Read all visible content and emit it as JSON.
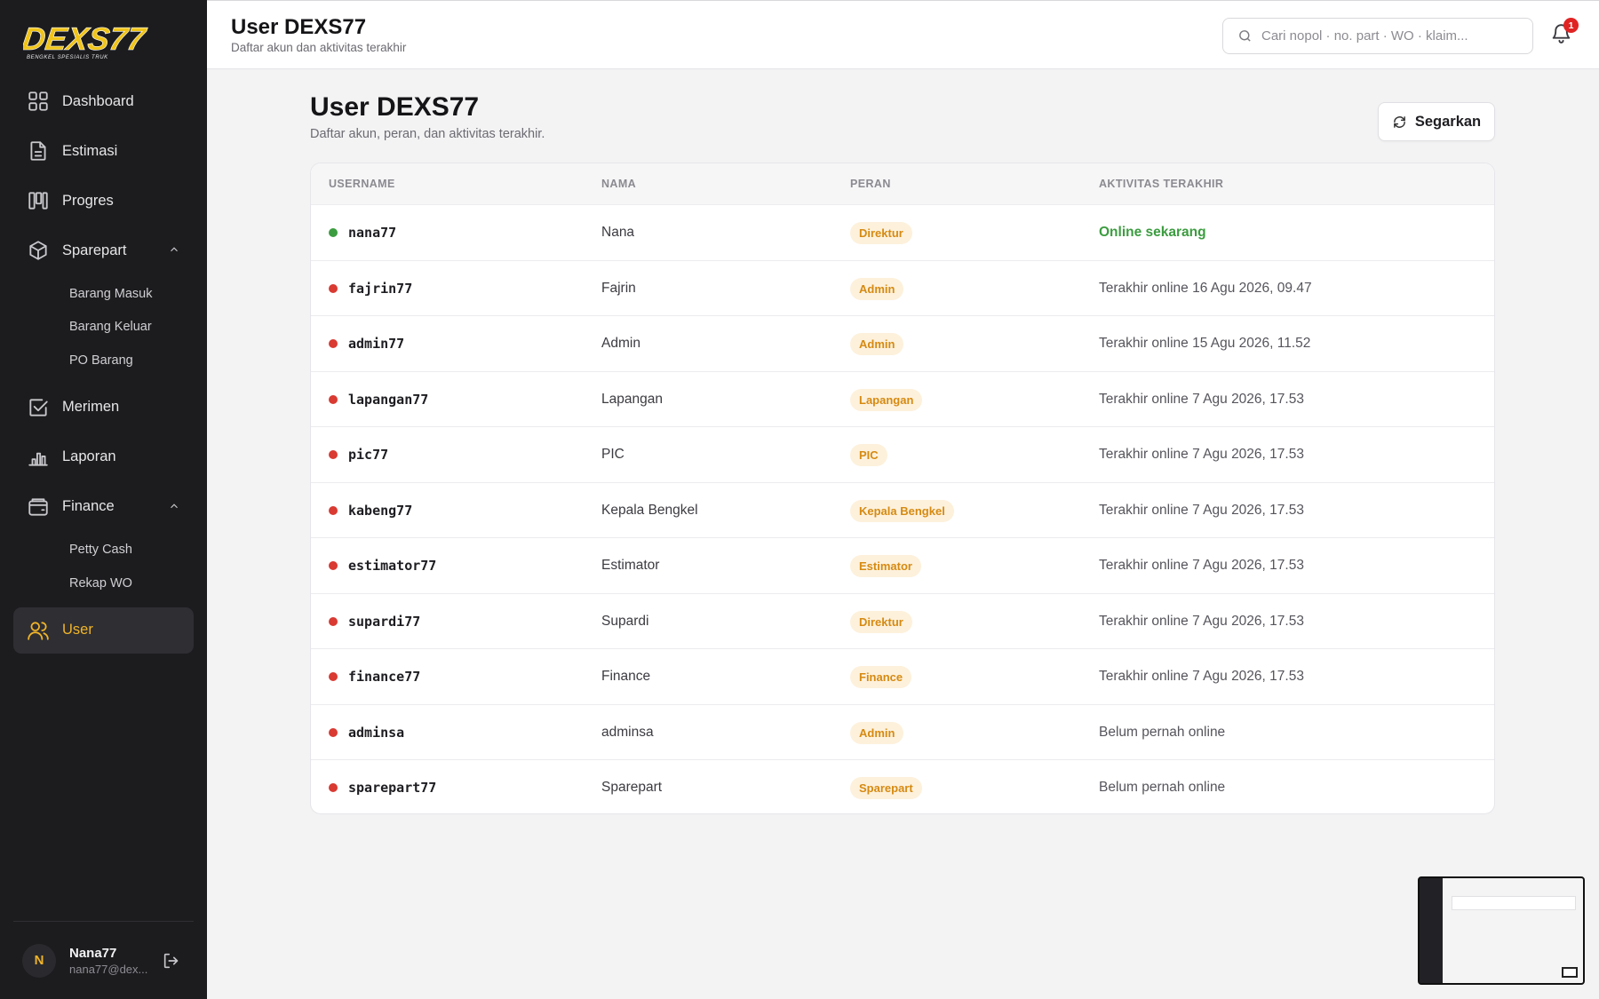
{
  "brand": {
    "logo_text": "DEXS77",
    "logo_tagline": "BENGKEL SPESIALIS TRUK",
    "accent": "#f0b429"
  },
  "sidebar": {
    "items": [
      {
        "label": "Dashboard",
        "icon": "grid-icon"
      },
      {
        "label": "Estimasi",
        "icon": "document-icon"
      },
      {
        "label": "Progres",
        "icon": "kanban-icon"
      },
      {
        "label": "Sparepart",
        "icon": "box-icon",
        "expanded": true,
        "children": [
          "Barang Masuk",
          "Barang Keluar",
          "PO Barang"
        ]
      },
      {
        "label": "Merimen",
        "icon": "checkbox-icon"
      },
      {
        "label": "Laporan",
        "icon": "bar-chart-icon"
      },
      {
        "label": "Finance",
        "icon": "wallet-icon",
        "expanded": true,
        "children": [
          "Petty Cash",
          "Rekap WO"
        ]
      },
      {
        "label": "User",
        "icon": "users-icon",
        "active": true
      }
    ],
    "profile": {
      "initial": "N",
      "name": "Nana77",
      "email": "nana77@dex..."
    }
  },
  "topbar": {
    "title": "User DEXS77",
    "subtitle": "Daftar akun dan aktivitas terakhir",
    "search_placeholder": "Cari nopol · no. part · WO · klaim...",
    "notification_count": "1"
  },
  "main": {
    "title": "User DEXS77",
    "subtitle": "Daftar akun, peran, dan aktivitas terakhir.",
    "refresh_label": "Segarkan",
    "columns": [
      "USERNAME",
      "NAMA",
      "PERAN",
      "AKTIVITAS TERAKHIR"
    ],
    "rows": [
      {
        "username": "nana77",
        "name": "Nana",
        "role": "Direktur",
        "activity": "Online sekarang",
        "online": true
      },
      {
        "username": "fajrin77",
        "name": "Fajrin",
        "role": "Admin",
        "activity": "Terakhir online 16 Agu 2026, 09.47",
        "online": false
      },
      {
        "username": "admin77",
        "name": "Admin",
        "role": "Admin",
        "activity": "Terakhir online 15 Agu 2026, 11.52",
        "online": false
      },
      {
        "username": "lapangan77",
        "name": "Lapangan",
        "role": "Lapangan",
        "activity": "Terakhir online 7 Agu 2026, 17.53",
        "online": false
      },
      {
        "username": "pic77",
        "name": "PIC",
        "role": "PIC",
        "activity": "Terakhir online 7 Agu 2026, 17.53",
        "online": false
      },
      {
        "username": "kabeng77",
        "name": "Kepala Bengkel",
        "role": "Kepala Bengkel",
        "activity": "Terakhir online 7 Agu 2026, 17.53",
        "online": false
      },
      {
        "username": "estimator77",
        "name": "Estimator",
        "role": "Estimator",
        "activity": "Terakhir online 7 Agu 2026, 17.53",
        "online": false
      },
      {
        "username": "supardi77",
        "name": "Supardi",
        "role": "Direktur",
        "activity": "Terakhir online 7 Agu 2026, 17.53",
        "online": false
      },
      {
        "username": "finance77",
        "name": "Finance",
        "role": "Finance",
        "activity": "Terakhir online 7 Agu 2026, 17.53",
        "online": false
      },
      {
        "username": "adminsa",
        "name": "adminsa",
        "role": "Admin",
        "activity": "Belum pernah online",
        "online": false
      },
      {
        "username": "sparepart77",
        "name": "Sparepart",
        "role": "Sparepart",
        "activity": "Belum pernah online",
        "online": false
      }
    ],
    "status_colors": {
      "online": "#3b9c3f",
      "offline": "#d93a32"
    }
  }
}
